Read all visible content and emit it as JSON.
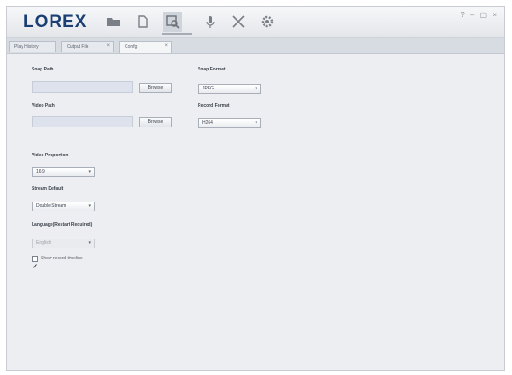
{
  "app": {
    "logo": "LOREX",
    "window_controls": "? – ▢ ×"
  },
  "toolbar": {
    "icons": [
      "folder-icon",
      "document-icon",
      "search-settings-icon",
      "microphone-icon",
      "fullscreen-icon",
      "gear-icon"
    ],
    "active": "search-settings-icon"
  },
  "tabs": [
    {
      "label": "Play History",
      "closable": false
    },
    {
      "label": "Output File",
      "closable": true
    },
    {
      "label": "Config",
      "closable": true
    }
  ],
  "config": {
    "snap_path_label": "Snap Path",
    "snap_path_value": "",
    "video_path_label": "Video Path",
    "video_path_value": "",
    "browse_label": "Browse",
    "image_format_label": "Snap Format",
    "image_format_value": "JPEG",
    "record_format_label": "Record Format",
    "record_format_value": "H264",
    "video_proportion_label": "Video Proportion",
    "video_proportion_value": "16:9",
    "stream_label": "Stream Default",
    "stream_value": "Double Stream",
    "language_label": "Language(Restart Required)",
    "language_value": "English",
    "checkbox_label": "Show record timeline",
    "checkbox_checked": true
  }
}
